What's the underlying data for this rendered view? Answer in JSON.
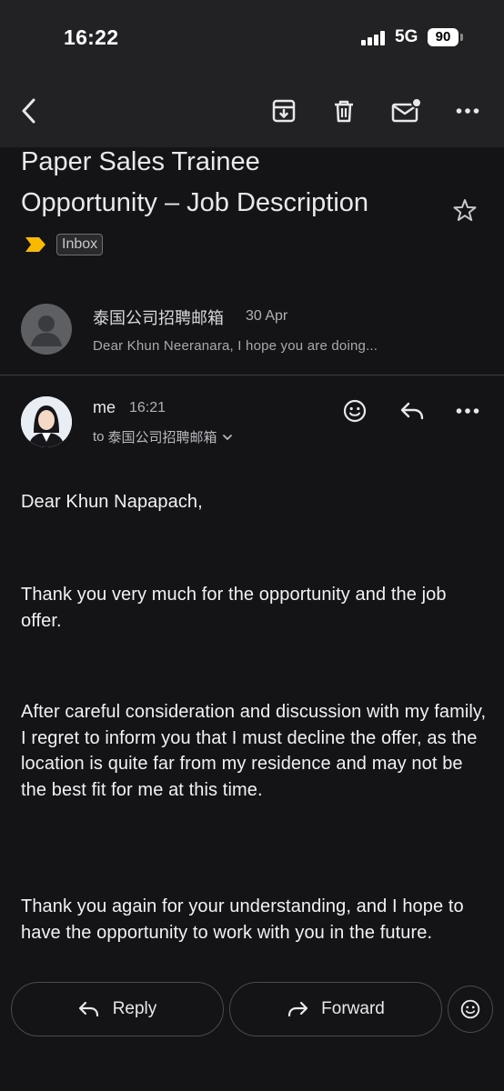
{
  "status_bar": {
    "time": "16:22",
    "network": "5G",
    "battery": "90"
  },
  "toolbar": {
    "back_icon": "back-arrow-icon",
    "archive_icon": "archive-icon",
    "delete_icon": "trash-icon",
    "mark_unread_icon": "mail-unread-icon",
    "more_icon": "more-horizontal-icon"
  },
  "email": {
    "subject_line1": "Paper Sales Trainee",
    "subject_line2": "Opportunity – Job Description",
    "label": "Inbox",
    "importance_color": "#f9b900"
  },
  "previous_message": {
    "sender": "泰国公司招聘邮箱",
    "date": "30 Apr",
    "snippet": "Dear Khun Neeranara, I hope you are doing..."
  },
  "current_message": {
    "sender": "me",
    "time": "16:21",
    "to_prefix": "to",
    "recipient": "泰国公司招聘邮箱",
    "body": {
      "greeting": "Dear Khun Napapach,",
      "p1": "Thank you very much for the opportunity and the job offer.",
      "p2": "After careful consideration and discussion with my family, I regret to inform you that I must decline the offer, as the location is quite far from my residence and may not be the best fit for me at this time.",
      "p3": "Thank you again for your understanding, and I hope to have the opportunity to work with you in the future."
    }
  },
  "actions": {
    "reply": "Reply",
    "forward": "Forward"
  }
}
